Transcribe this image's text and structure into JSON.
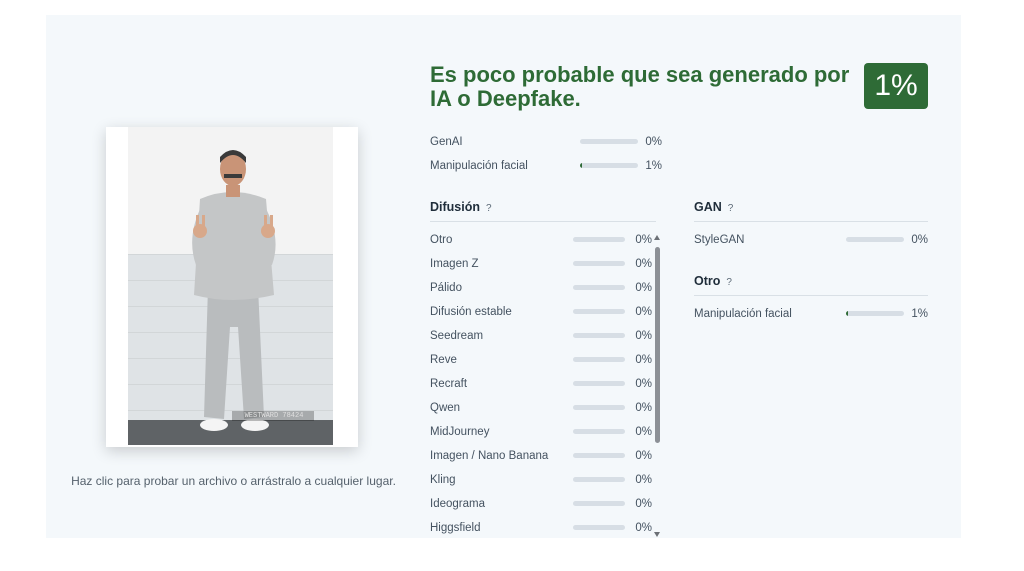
{
  "verdict": {
    "title": "Es poco probable que sea generado por IA o Deepfake.",
    "score": "1%",
    "score_value": 0.01,
    "color": "#2e6b36"
  },
  "upload": {
    "hint": "Haz clic para probar un archivo o arrástralo a cualquier lugar.",
    "image_caption": "WESTWARD 78424"
  },
  "summary": [
    {
      "label": "GenAI",
      "pct": "0%",
      "value": 0
    },
    {
      "label": "Manipulación facial",
      "pct": "1%",
      "value": 0.01
    }
  ],
  "difusion": {
    "title": "Difusión",
    "help": "?",
    "items": [
      {
        "label": "Otro",
        "pct": "0%",
        "value": 0
      },
      {
        "label": "Imagen Z",
        "pct": "0%",
        "value": 0
      },
      {
        "label": "Pálido",
        "pct": "0%",
        "value": 0
      },
      {
        "label": "Difusión estable",
        "pct": "0%",
        "value": 0
      },
      {
        "label": "Seedream",
        "pct": "0%",
        "value": 0
      },
      {
        "label": "Reve",
        "pct": "0%",
        "value": 0
      },
      {
        "label": "Recraft",
        "pct": "0%",
        "value": 0
      },
      {
        "label": "Qwen",
        "pct": "0%",
        "value": 0
      },
      {
        "label": "MidJourney",
        "pct": "0%",
        "value": 0
      },
      {
        "label": "Imagen / Nano Banana",
        "pct": "0%",
        "value": 0
      },
      {
        "label": "Kling",
        "pct": "0%",
        "value": 0
      },
      {
        "label": "Ideograma",
        "pct": "0%",
        "value": 0
      },
      {
        "label": "Higgsfield",
        "pct": "0%",
        "value": 0
      }
    ]
  },
  "gan": {
    "title": "GAN",
    "help": "?",
    "items": [
      {
        "label": "StyleGAN",
        "pct": "0%",
        "value": 0
      }
    ]
  },
  "otro": {
    "title": "Otro",
    "help": "?",
    "items": [
      {
        "label": "Manipulación facial",
        "pct": "1%",
        "value": 0.01
      }
    ]
  }
}
